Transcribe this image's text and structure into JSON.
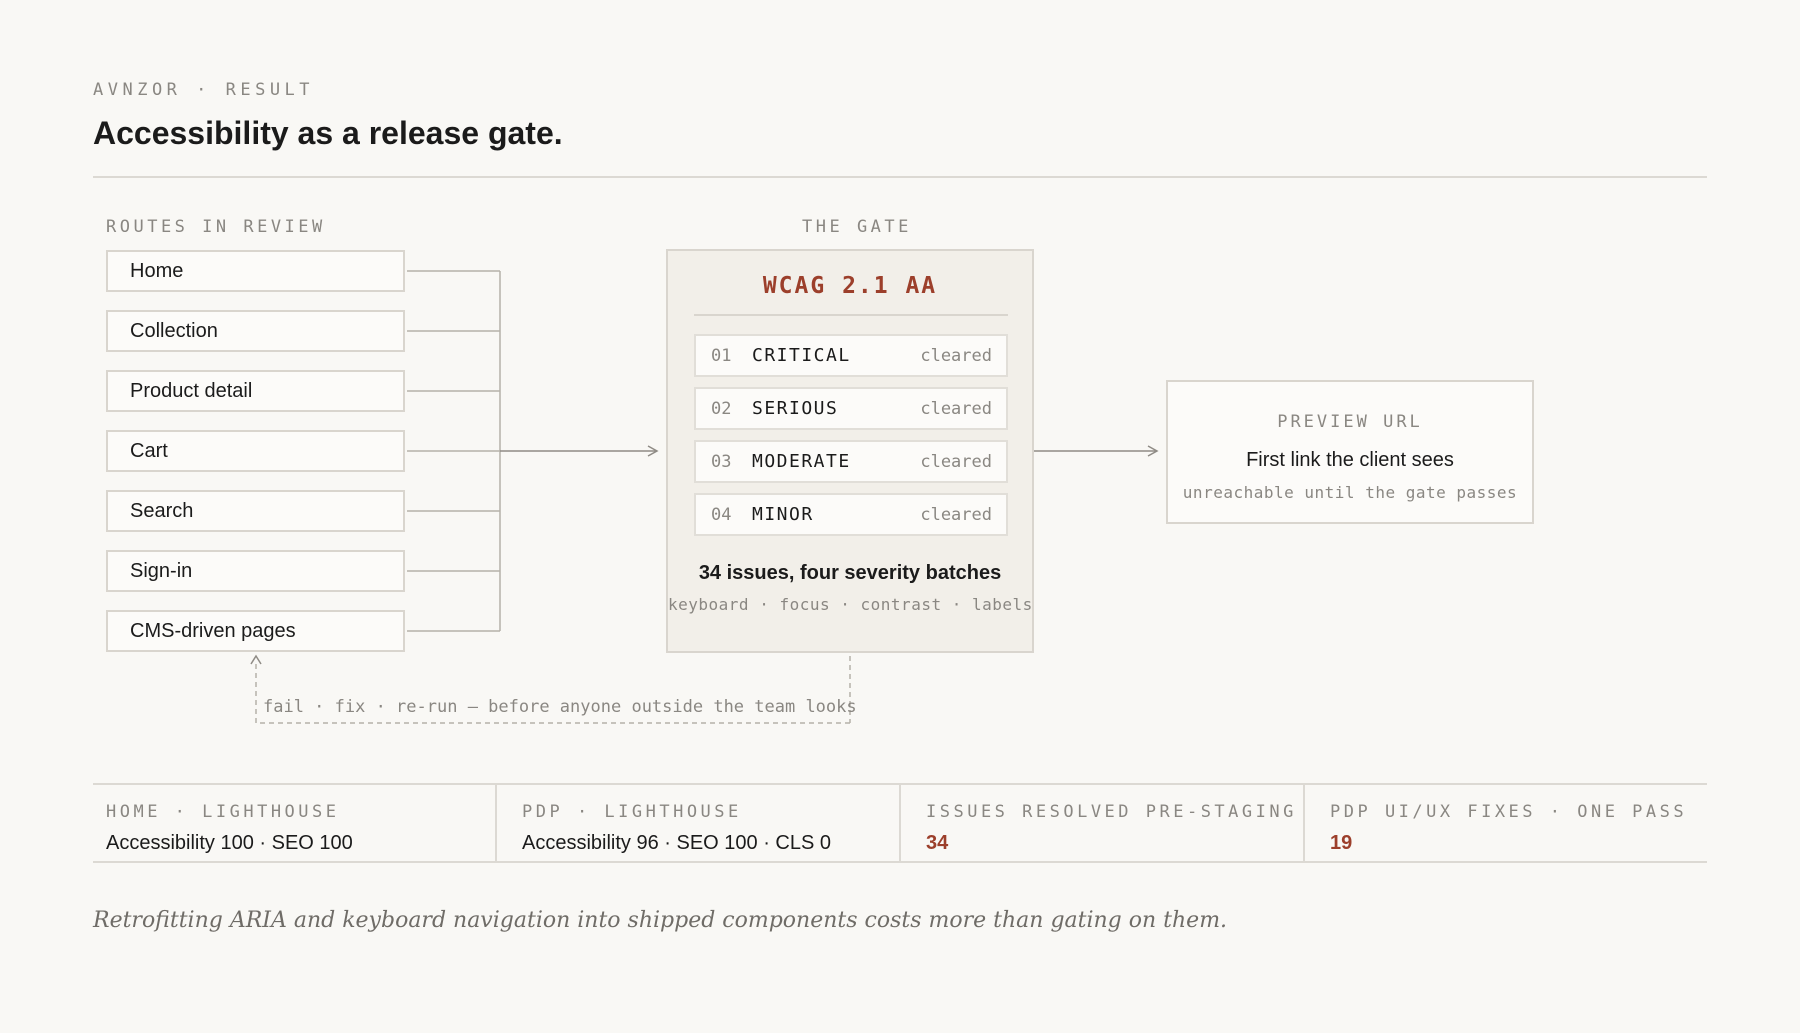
{
  "header": {
    "eyebrow": "AVNZOR · RESULT",
    "title": "Accessibility as a release gate."
  },
  "routes": {
    "label": "ROUTES IN REVIEW",
    "items": [
      "Home",
      "Collection",
      "Product detail",
      "Cart",
      "Search",
      "Sign-in",
      "CMS-driven pages"
    ]
  },
  "gate": {
    "label": "THE GATE",
    "standard": "WCAG 2.1 AA",
    "batches": [
      {
        "num": "01",
        "name": "CRITICAL",
        "status": "cleared"
      },
      {
        "num": "02",
        "name": "SERIOUS",
        "status": "cleared"
      },
      {
        "num": "03",
        "name": "MODERATE",
        "status": "cleared"
      },
      {
        "num": "04",
        "name": "MINOR",
        "status": "cleared"
      }
    ],
    "summary": "34 issues, four severity batches",
    "tags": "keyboard · focus · contrast · labels"
  },
  "preview": {
    "label": "PREVIEW URL",
    "text": "First link the client sees",
    "sub": "unreachable until the gate passes"
  },
  "loop": {
    "label": "fail · fix · re-run — before anyone outside the team looks"
  },
  "metrics": [
    {
      "label": "HOME · LIGHTHOUSE",
      "value": "Accessibility 100 · SEO 100"
    },
    {
      "label": "PDP · LIGHTHOUSE",
      "value": "Accessibility 96 · SEO 100 · CLS 0"
    },
    {
      "label": "ISSUES RESOLVED PRE-STAGING",
      "value": "34"
    },
    {
      "label": "PDP UI/UX FIXES · ONE PASS",
      "value": "19"
    }
  ],
  "footnote": "Retrofitting ARIA and keyboard navigation into shipped components costs more than gating on them.",
  "colors": {
    "accent": "#9c3f2b",
    "muted": "#8a8782",
    "border": "#d9d5ce",
    "background": "#f9f8f5"
  }
}
